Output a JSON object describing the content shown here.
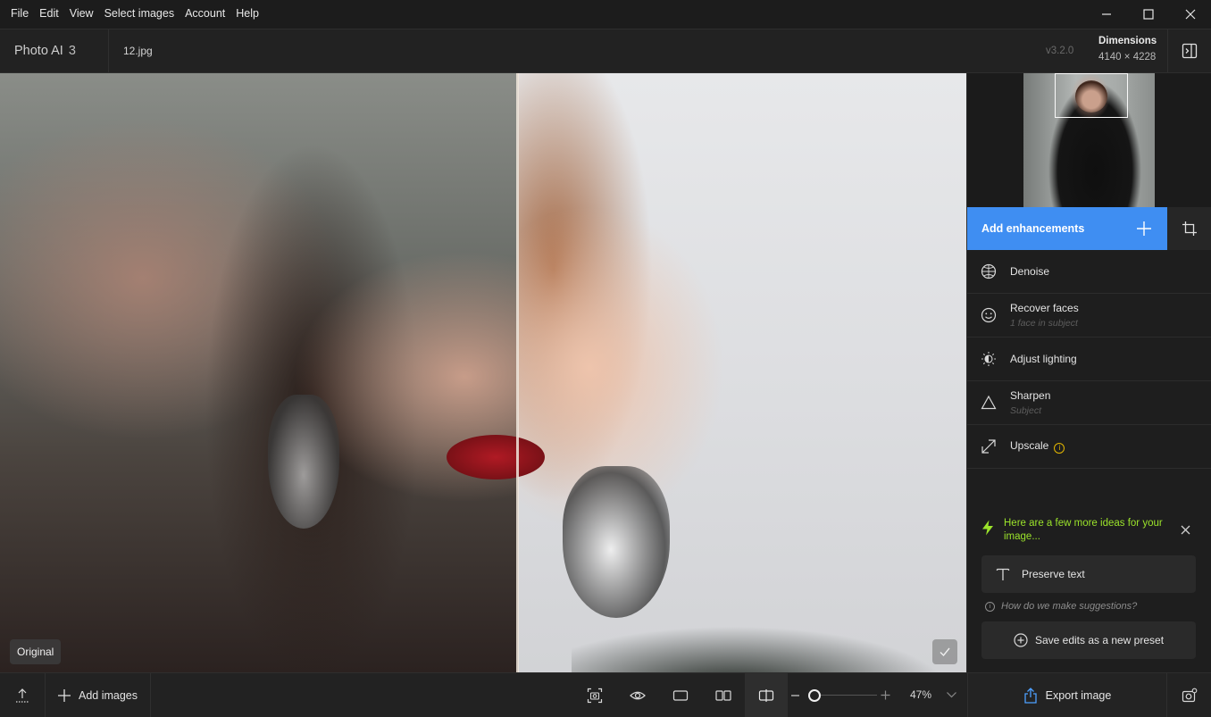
{
  "menu": [
    "File",
    "Edit",
    "View",
    "Select images",
    "Account",
    "Help"
  ],
  "header": {
    "app_name": "Photo AI",
    "app_version_major": "3",
    "filename": "12.jpg",
    "version": "v3.2.0",
    "dimensions_label": "Dimensions",
    "dimensions_value": "4140 × 4228"
  },
  "canvas": {
    "original_badge": "Original"
  },
  "panel": {
    "add_enhancements": "Add enhancements",
    "enhancements": [
      {
        "name": "Denoise",
        "sub": "",
        "icon": "denoise-icon"
      },
      {
        "name": "Recover faces",
        "sub": "1 face in subject",
        "icon": "face-icon"
      },
      {
        "name": "Adjust lighting",
        "sub": "",
        "icon": "lighting-icon"
      },
      {
        "name": "Sharpen",
        "sub": "Subject",
        "icon": "sharpen-icon"
      },
      {
        "name": "Upscale",
        "sub": "",
        "icon": "upscale-icon",
        "info": "i"
      }
    ],
    "ideas_message": "Here are a few more ideas for your image...",
    "suggestion_label": "Preserve text",
    "how_suggestions": "How do we make suggestions?",
    "save_preset": "Save edits as a new preset"
  },
  "bottom": {
    "add_images": "Add images",
    "zoom_percent": "47%",
    "zoom_level": 0.06,
    "export_label": "Export image"
  },
  "colors": {
    "accent": "#3f8ef2",
    "idea_text": "#9be32b",
    "warning": "#e2b600"
  }
}
